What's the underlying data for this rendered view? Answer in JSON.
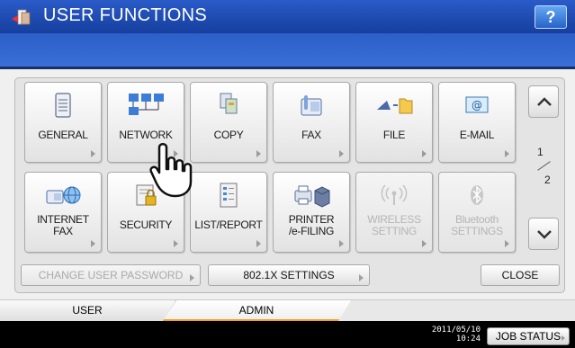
{
  "header": {
    "title": "USER FUNCTIONS",
    "help_label": "?"
  },
  "functions": [
    {
      "label": "GENERAL",
      "icon": "document-icon"
    },
    {
      "label": "NETWORK",
      "icon": "network-icon"
    },
    {
      "label": "COPY",
      "icon": "copy-icon"
    },
    {
      "label": "FAX",
      "icon": "fax-icon"
    },
    {
      "label": "FILE",
      "icon": "file-icon"
    },
    {
      "label": "E-MAIL",
      "icon": "email-icon"
    },
    {
      "label": "INTERNET\nFAX",
      "icon": "internet-fax-icon"
    },
    {
      "label": "SECURITY",
      "icon": "security-icon"
    },
    {
      "label": "LIST/REPORT",
      "icon": "list-report-icon"
    },
    {
      "label": "PRINTER\n/e-FILING",
      "icon": "printer-icon"
    },
    {
      "label": "WIRELESS\nSETTING",
      "icon": "wireless-icon",
      "disabled": true
    },
    {
      "label": "Bluetooth\nSETTINGS",
      "icon": "bluetooth-icon",
      "disabled": true
    }
  ],
  "pager": {
    "current": "1",
    "total": "2"
  },
  "actions": {
    "change_password": "CHANGE USER PASSWORD",
    "dot1x": "802.1X SETTINGS",
    "close": "CLOSE"
  },
  "tabs": {
    "user": "USER",
    "admin": "ADMIN"
  },
  "status": {
    "date": "2011/05/10",
    "time": "10:24",
    "job_status": "JOB STATUS"
  },
  "colors": {
    "title_bar": "#1f4fb8",
    "active_tab_accent": "#f2a21a"
  }
}
